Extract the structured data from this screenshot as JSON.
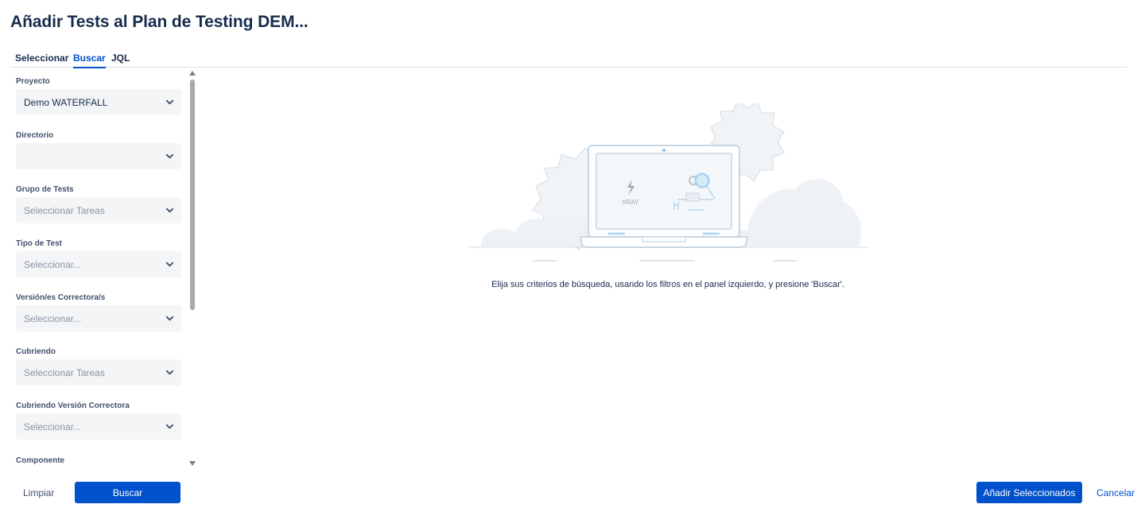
{
  "dialog": {
    "title": "Añadir Tests al Plan de Testing DEM..."
  },
  "tabs": [
    {
      "label": "Seleccionar",
      "active": false
    },
    {
      "label": "Buscar",
      "active": true
    },
    {
      "label": "JQL",
      "active": false
    }
  ],
  "filters": [
    {
      "label": "Proyecto",
      "value": "Demo WATERFALL",
      "placeholder": ""
    },
    {
      "label": "Directorio",
      "value": "",
      "placeholder": ""
    },
    {
      "label": "Grupo de Tests",
      "value": "",
      "placeholder": "Seleccionar Tareas"
    },
    {
      "label": "Tipo de Test",
      "value": "",
      "placeholder": "Seleccionar..."
    },
    {
      "label": "Versión/es Correctora/s",
      "value": "",
      "placeholder": "Seleccionar..."
    },
    {
      "label": "Cubriendo",
      "value": "",
      "placeholder": "Seleccionar Tareas"
    },
    {
      "label": "Cubriendo Versión Correctora",
      "value": "",
      "placeholder": "Seleccionar..."
    },
    {
      "label": "Componente",
      "value": "",
      "placeholder": ""
    }
  ],
  "illustration": {
    "brand_text": "XRAY"
  },
  "empty_state": {
    "message": "Elija sus criterios de búsqueda, usando los filtros en el panel izquierdo, y presione 'Buscar'."
  },
  "footer": {
    "clear_label": "Limpiar",
    "search_label": "Buscar",
    "add_selected_label": "Añadir Seleccionados",
    "cancel_label": "Cancelar"
  },
  "colors": {
    "primary": "#0052cc",
    "text": "#172b4d",
    "field_bg": "#f4f5f7"
  }
}
